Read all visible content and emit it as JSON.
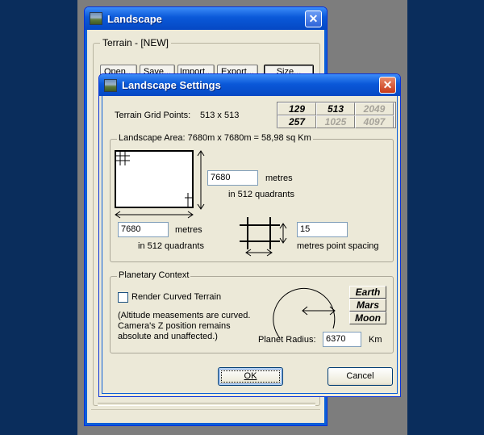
{
  "back_window": {
    "title": "Landscape",
    "group_label": "Terrain - [NEW]",
    "buttons": {
      "open": "Open...",
      "save": "Save...",
      "import": "Import...",
      "export": "Export...",
      "size": "Size..."
    }
  },
  "dialog": {
    "title": "Landscape Settings",
    "grid_points_label": "Terrain Grid Points:",
    "grid_points_value": "513 x 513",
    "grid_options": [
      {
        "label": "129",
        "enabled": true
      },
      {
        "label": "513",
        "enabled": true
      },
      {
        "label": "2049",
        "enabled": false
      },
      {
        "label": "257",
        "enabled": true
      },
      {
        "label": "1025",
        "enabled": false
      },
      {
        "label": "4097",
        "enabled": false
      }
    ],
    "area_legend": "Landscape Area: 7680m x 7680m  =  58,98 sq Km",
    "height_value": "7680",
    "height_unit": "metres",
    "height_quadrants": "in 512 quadrants",
    "width_value": "7680",
    "width_unit": "metres",
    "width_quadrants": "in 512 quadrants",
    "spacing_value": "15",
    "spacing_label": "metres point spacing",
    "planetary_legend": "Planetary Context",
    "curved_terrain_label": "Render Curved Terrain",
    "curved_terrain_checked": false,
    "curved_note_1": "(Altitude measements are curved.",
    "curved_note_2": "Camera's Z position remains",
    "curved_note_3": "absolute and unaffected.)",
    "planet_buttons": [
      "Earth",
      "Mars",
      "Moon"
    ],
    "radius_label": "Planet Radius:",
    "radius_value": "6370",
    "radius_unit": "Km",
    "ok_label": "OK",
    "cancel_label": "Cancel"
  },
  "colors": {
    "desktop": "#0a2d5c",
    "titlebar": "#0a58d8",
    "dialog_face": "#ece9d8",
    "close_red": "#c83a1a"
  }
}
